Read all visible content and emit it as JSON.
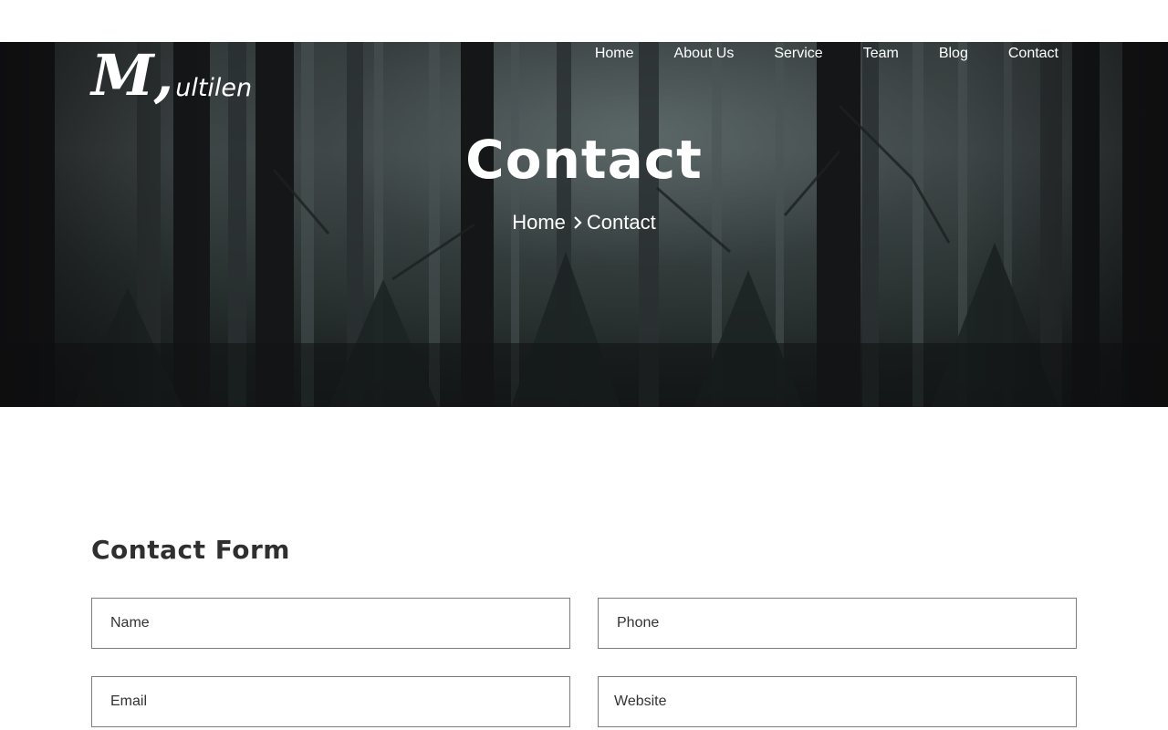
{
  "brand": {
    "logo_initial": "M,",
    "logo_rest": "ultilen"
  },
  "nav": {
    "items": [
      {
        "label": "Home"
      },
      {
        "label": "About Us"
      },
      {
        "label": "Service"
      },
      {
        "label": "Team"
      },
      {
        "label": "Blog"
      },
      {
        "label": "Contact"
      }
    ]
  },
  "hero": {
    "title": "Contact",
    "breadcrumb": {
      "home": "Home",
      "separator_icon": "chevron-right-icon",
      "current": "Contact"
    }
  },
  "contact_form": {
    "title": "Contact Form",
    "fields": {
      "name": {
        "placeholder": "Name",
        "value": ""
      },
      "phone": {
        "placeholder": "Phone",
        "value": ""
      },
      "email": {
        "placeholder": "Email",
        "value": ""
      },
      "website": {
        "placeholder": "Website",
        "value": ""
      }
    }
  },
  "colors": {
    "text_dark": "#2f2f2f",
    "field_border": "#7d7d7d",
    "hero_overlay": "#2f3536",
    "text_light": "#ffffff"
  }
}
